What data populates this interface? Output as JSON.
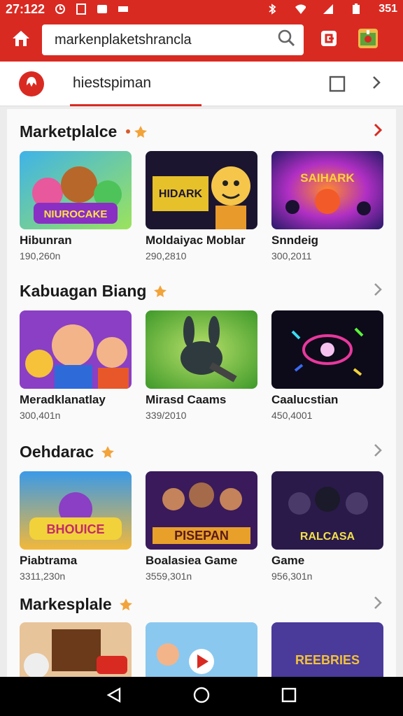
{
  "status_bar": {
    "time": "27:122",
    "right_text": "351"
  },
  "app_bar": {
    "search_query": "markenplaketshrancla"
  },
  "tabs": {
    "active_label": "hiestspiman"
  },
  "sections": [
    {
      "title": "Marketplalce",
      "cards": [
        {
          "name": "Hibunran",
          "meta": "190,260n",
          "thumb_text": "NIUROCAKE"
        },
        {
          "name": "Moldaiyac Moblar",
          "meta": "290,2810",
          "thumb_text": "HIDARK"
        },
        {
          "name": "Snndeig",
          "meta": "300,2011",
          "thumb_text": "SAIHARK"
        }
      ]
    },
    {
      "title": "Kabuagan Biang",
      "cards": [
        {
          "name": "Meradklanatlay",
          "meta": "300,401n",
          "thumb_text": ""
        },
        {
          "name": "Mirasd Caams",
          "meta": "339/2010",
          "thumb_text": ""
        },
        {
          "name": "Caalucstian",
          "meta": "450,4001",
          "thumb_text": ""
        }
      ]
    },
    {
      "title": "Oehdarac",
      "cards": [
        {
          "name": "Piabtrama",
          "meta": "3311,230n",
          "thumb_text": "BHOUICE"
        },
        {
          "name": "Boalasiea Game",
          "meta": "3559,301n",
          "thumb_text": "PISEPAN"
        },
        {
          "name": "Game",
          "meta": "956,301n",
          "thumb_text": "RALCASA"
        }
      ]
    },
    {
      "title": "Markesplale",
      "cards": [
        {
          "name": "",
          "meta": "",
          "thumb_text": ""
        },
        {
          "name": "",
          "meta": "",
          "thumb_text": ""
        },
        {
          "name": "",
          "meta": "",
          "thumb_text": "REEBRIES"
        }
      ]
    }
  ],
  "colors": {
    "brand_red": "#d92a22",
    "accent_orange": "#f2a33a"
  },
  "icons": [
    "home-icon",
    "search-icon",
    "share-icon",
    "gift-icon",
    "logo-icon",
    "square-icon",
    "chevron-right-icon",
    "star-icon",
    "back-icon",
    "home-circle-icon",
    "recents-icon"
  ]
}
